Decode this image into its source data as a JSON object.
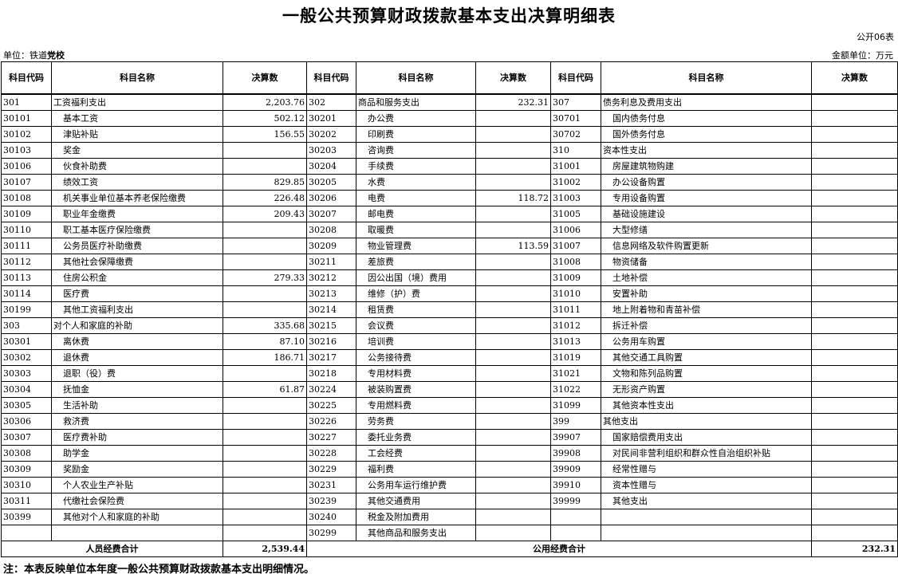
{
  "title": "一般公共预算财政拨款基本支出决算明细表",
  "form_no": "公开06表",
  "unit_label": "单位：铁道",
  "unit_name": "党校",
  "amount_unit": "金额单位：万元",
  "headers": [
    "科目代码",
    "科目名称",
    "决算数",
    "科目代码",
    "科目名称",
    "决算数",
    "科目代码",
    "科目名称",
    "决算数"
  ],
  "rows": [
    [
      {
        "c": "301",
        "n": "工资福利支出",
        "a": "2,203.76"
      },
      {
        "c": "302",
        "n": "商品和服务支出",
        "a": "232.31"
      },
      {
        "c": "307",
        "n": "债务利息及费用支出",
        "a": ""
      }
    ],
    [
      {
        "c": "30101",
        "n": "基本工资",
        "a": "502.12",
        "s": 1
      },
      {
        "c": "30201",
        "n": "办公费",
        "a": "",
        "s": 1
      },
      {
        "c": "30701",
        "n": "国内债务付息",
        "a": "",
        "s": 1
      }
    ],
    [
      {
        "c": "30102",
        "n": "津贴补贴",
        "a": "156.55",
        "s": 1
      },
      {
        "c": "30202",
        "n": "印刷费",
        "a": "",
        "s": 1
      },
      {
        "c": "30702",
        "n": "国外债务付息",
        "a": "",
        "s": 1
      }
    ],
    [
      {
        "c": "30103",
        "n": "奖金",
        "a": "",
        "s": 1
      },
      {
        "c": "30203",
        "n": "咨询费",
        "a": "",
        "s": 1
      },
      {
        "c": "310",
        "n": "资本性支出",
        "a": ""
      }
    ],
    [
      {
        "c": "30106",
        "n": "伙食补助费",
        "a": "",
        "s": 1
      },
      {
        "c": "30204",
        "n": "手续费",
        "a": "",
        "s": 1
      },
      {
        "c": "31001",
        "n": "房屋建筑物购建",
        "a": "",
        "s": 1
      }
    ],
    [
      {
        "c": "30107",
        "n": "绩效工资",
        "a": "829.85",
        "s": 1
      },
      {
        "c": "30205",
        "n": "水费",
        "a": "",
        "s": 1
      },
      {
        "c": "31002",
        "n": "办公设备购置",
        "a": "",
        "s": 1
      }
    ],
    [
      {
        "c": "30108",
        "n": "机关事业单位基本养老保险缴费",
        "a": "226.48",
        "s": 1
      },
      {
        "c": "30206",
        "n": "电费",
        "a": "118.72",
        "s": 1
      },
      {
        "c": "31003",
        "n": "专用设备购置",
        "a": "",
        "s": 1
      }
    ],
    [
      {
        "c": "30109",
        "n": "职业年金缴费",
        "a": "209.43",
        "s": 1
      },
      {
        "c": "30207",
        "n": "邮电费",
        "a": "",
        "s": 1
      },
      {
        "c": "31005",
        "n": "基础设施建设",
        "a": "",
        "s": 1
      }
    ],
    [
      {
        "c": "30110",
        "n": "职工基本医疗保险缴费",
        "a": "",
        "s": 1
      },
      {
        "c": "30208",
        "n": "取暖费",
        "a": "",
        "s": 1
      },
      {
        "c": "31006",
        "n": "大型修缮",
        "a": "",
        "s": 1
      }
    ],
    [
      {
        "c": "30111",
        "n": "公务员医疗补助缴费",
        "a": "",
        "s": 1
      },
      {
        "c": "30209",
        "n": "物业管理费",
        "a": "113.59",
        "s": 1
      },
      {
        "c": "31007",
        "n": "信息网络及软件购置更新",
        "a": "",
        "s": 1
      }
    ],
    [
      {
        "c": "30112",
        "n": "其他社会保障缴费",
        "a": "",
        "s": 1
      },
      {
        "c": "30211",
        "n": "差旅费",
        "a": "",
        "s": 1
      },
      {
        "c": "31008",
        "n": "物资储备",
        "a": "",
        "s": 1
      }
    ],
    [
      {
        "c": "30113",
        "n": "住房公积金",
        "a": "279.33",
        "s": 1
      },
      {
        "c": "30212",
        "n": "因公出国（境）费用",
        "a": "",
        "s": 1
      },
      {
        "c": "31009",
        "n": "土地补偿",
        "a": "",
        "s": 1
      }
    ],
    [
      {
        "c": "30114",
        "n": "医疗费",
        "a": "",
        "s": 1
      },
      {
        "c": "30213",
        "n": "维修（护）费",
        "a": "",
        "s": 1
      },
      {
        "c": "31010",
        "n": "安置补助",
        "a": "",
        "s": 1
      }
    ],
    [
      {
        "c": "30199",
        "n": "其他工资福利支出",
        "a": "",
        "s": 1
      },
      {
        "c": "30214",
        "n": "租赁费",
        "a": "",
        "s": 1
      },
      {
        "c": "31011",
        "n": "地上附着物和青苗补偿",
        "a": "",
        "s": 1
      }
    ],
    [
      {
        "c": "303",
        "n": "对个人和家庭的补助",
        "a": "335.68"
      },
      {
        "c": "30215",
        "n": "会议费",
        "a": "",
        "s": 1
      },
      {
        "c": "31012",
        "n": "拆迁补偿",
        "a": "",
        "s": 1
      }
    ],
    [
      {
        "c": "30301",
        "n": "离休费",
        "a": "87.10",
        "s": 1
      },
      {
        "c": "30216",
        "n": "培训费",
        "a": "",
        "s": 1
      },
      {
        "c": "31013",
        "n": "公务用车购置",
        "a": "",
        "s": 1
      }
    ],
    [
      {
        "c": "30302",
        "n": "退休费",
        "a": "186.71",
        "s": 1
      },
      {
        "c": "30217",
        "n": "公务接待费",
        "a": "",
        "s": 1
      },
      {
        "c": "31019",
        "n": "其他交通工具购置",
        "a": "",
        "s": 1
      }
    ],
    [
      {
        "c": "30303",
        "n": "退职（役）费",
        "a": "",
        "s": 1
      },
      {
        "c": "30218",
        "n": "专用材料费",
        "a": "",
        "s": 1
      },
      {
        "c": "31021",
        "n": "文物和陈列品购置",
        "a": "",
        "s": 1
      }
    ],
    [
      {
        "c": "30304",
        "n": "抚恤金",
        "a": "61.87",
        "s": 1
      },
      {
        "c": "30224",
        "n": "被装购置费",
        "a": "",
        "s": 1
      },
      {
        "c": "31022",
        "n": "无形资产购置",
        "a": "",
        "s": 1
      }
    ],
    [
      {
        "c": "30305",
        "n": "生活补助",
        "a": "",
        "s": 1
      },
      {
        "c": "30225",
        "n": "专用燃料费",
        "a": "",
        "s": 1
      },
      {
        "c": "31099",
        "n": "其他资本性支出",
        "a": "",
        "s": 1
      }
    ],
    [
      {
        "c": "30306",
        "n": "救济费",
        "a": "",
        "s": 1
      },
      {
        "c": "30226",
        "n": "劳务费",
        "a": "",
        "s": 1
      },
      {
        "c": "399",
        "n": "其他支出",
        "a": ""
      }
    ],
    [
      {
        "c": "30307",
        "n": "医疗费补助",
        "a": "",
        "s": 1
      },
      {
        "c": "30227",
        "n": "委托业务费",
        "a": "",
        "s": 1
      },
      {
        "c": "39907",
        "n": "国家赔偿费用支出",
        "a": "",
        "s": 1
      }
    ],
    [
      {
        "c": "30308",
        "n": "助学金",
        "a": "",
        "s": 1
      },
      {
        "c": "30228",
        "n": "工会经费",
        "a": "",
        "s": 1
      },
      {
        "c": "39908",
        "n": "对民间非营利组织和群众性自治组织补贴",
        "a": "",
        "s": 1
      }
    ],
    [
      {
        "c": "30309",
        "n": "奖励金",
        "a": "",
        "s": 1
      },
      {
        "c": "30229",
        "n": "福利费",
        "a": "",
        "s": 1
      },
      {
        "c": "39909",
        "n": "经常性赠与",
        "a": "",
        "s": 1
      }
    ],
    [
      {
        "c": "30310",
        "n": "个人农业生产补贴",
        "a": "",
        "s": 1
      },
      {
        "c": "30231",
        "n": "公务用车运行维护费",
        "a": "",
        "s": 1
      },
      {
        "c": "39910",
        "n": "资本性赠与",
        "a": "",
        "s": 1
      }
    ],
    [
      {
        "c": "30311",
        "n": "代缴社会保险费",
        "a": "",
        "s": 1
      },
      {
        "c": "30239",
        "n": "其他交通费用",
        "a": "",
        "s": 1
      },
      {
        "c": "39999",
        "n": "其他支出",
        "a": "",
        "s": 1
      }
    ],
    [
      {
        "c": "30399",
        "n": "其他对个人和家庭的补助",
        "a": "",
        "s": 1
      },
      {
        "c": "30240",
        "n": "税金及附加费用",
        "a": "",
        "s": 1
      },
      {
        "c": "",
        "n": "",
        "a": ""
      }
    ],
    [
      {
        "c": "",
        "n": "",
        "a": ""
      },
      {
        "c": "30299",
        "n": "其他商品和服务支出",
        "a": "",
        "s": 1
      },
      {
        "c": "",
        "n": "",
        "a": ""
      }
    ]
  ],
  "totals": {
    "personnel_label": "人员经费合计",
    "personnel_value": "2,539.44",
    "public_label": "公用经费合计",
    "public_value": "232.31"
  },
  "note": "注：本表反映单位本年度一般公共预算财政拨款基本支出明细情况。"
}
